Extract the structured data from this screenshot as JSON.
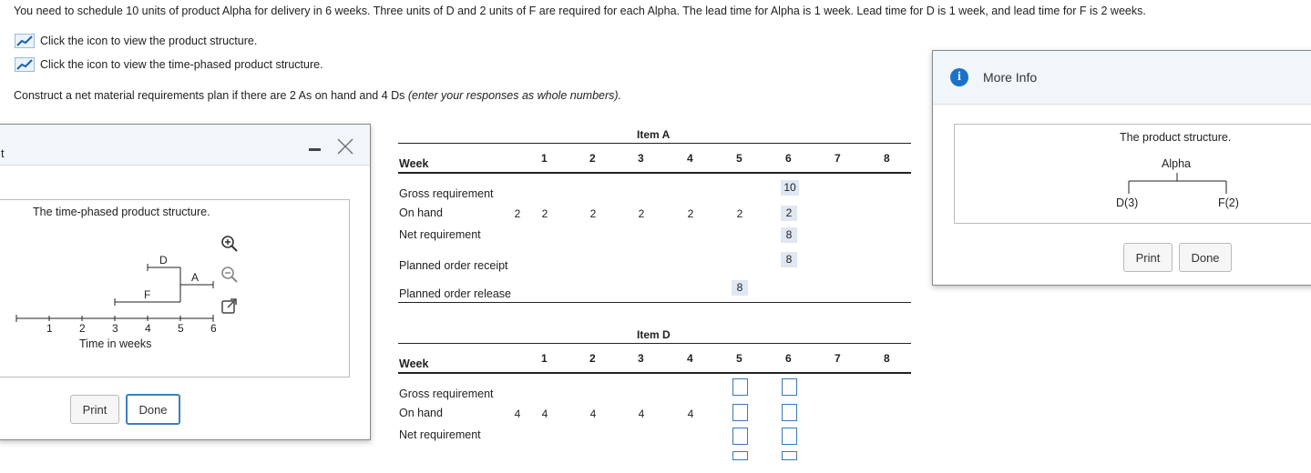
{
  "problem_text": "You need to schedule 10 units of product Alpha for delivery in 6 weeks. Three units of D and 2 units of F are required for each Alpha. The lead time for Alpha is 1 week. Lead time for D is 1 week, and lead time for F is 2 weeks.",
  "links": {
    "product_structure": "Click the icon to view the product structure.",
    "time_phased": "Click the icon to view the time-phased product structure."
  },
  "instruction_main": "Construct a net material requirements plan if there are 2 As on hand and 4 Ds ",
  "instruction_italic": "(enter your responses as whole numbers).",
  "left_dialog": {
    "title_fragment": "t",
    "caption": "The time-phased product structure.",
    "chart": {
      "x_ticks": [
        "1",
        "2",
        "3",
        "4",
        "5",
        "6"
      ],
      "xlabel": "Time in weeks",
      "labels": {
        "D": "D",
        "A": "A",
        "F": "F"
      }
    },
    "print_label": "Print",
    "done_label": "Done"
  },
  "item_a": {
    "title": "Item A",
    "week_label": "Week",
    "weeks": [
      "1",
      "2",
      "3",
      "4",
      "5",
      "6",
      "7",
      "8"
    ],
    "rows": {
      "gross": "Gross requirement",
      "on_hand": "On hand",
      "net": "Net requirement",
      "receipt": "Planned order receipt",
      "release": "Planned order release"
    },
    "on_hand_initial": "2",
    "on_hand_values": [
      "2",
      "2",
      "2",
      "2",
      "2",
      "2"
    ],
    "gross_w6": "10",
    "net_w6": "8",
    "receipt_w6": "8",
    "release_w5": "8"
  },
  "item_d": {
    "title": "Item D",
    "week_label": "Week",
    "weeks": [
      "1",
      "2",
      "3",
      "4",
      "5",
      "6",
      "7",
      "8"
    ],
    "rows": {
      "gross": "Gross requirement",
      "on_hand": "On hand",
      "net": "Net requirement"
    },
    "on_hand_initial": "4",
    "on_hand_values": [
      "4",
      "4",
      "4",
      "4"
    ]
  },
  "right_dialog": {
    "title": "More Info",
    "caption": "The product structure.",
    "root": "Alpha",
    "children": [
      "D(3)",
      "F(2)"
    ],
    "print_label": "Print",
    "done_label": "Done"
  },
  "colors": {
    "accent": "#1a73c9",
    "input_border": "#3a78b8",
    "shaded_cell": "#dfe7f3",
    "titlebar": "#f1f6fb"
  }
}
